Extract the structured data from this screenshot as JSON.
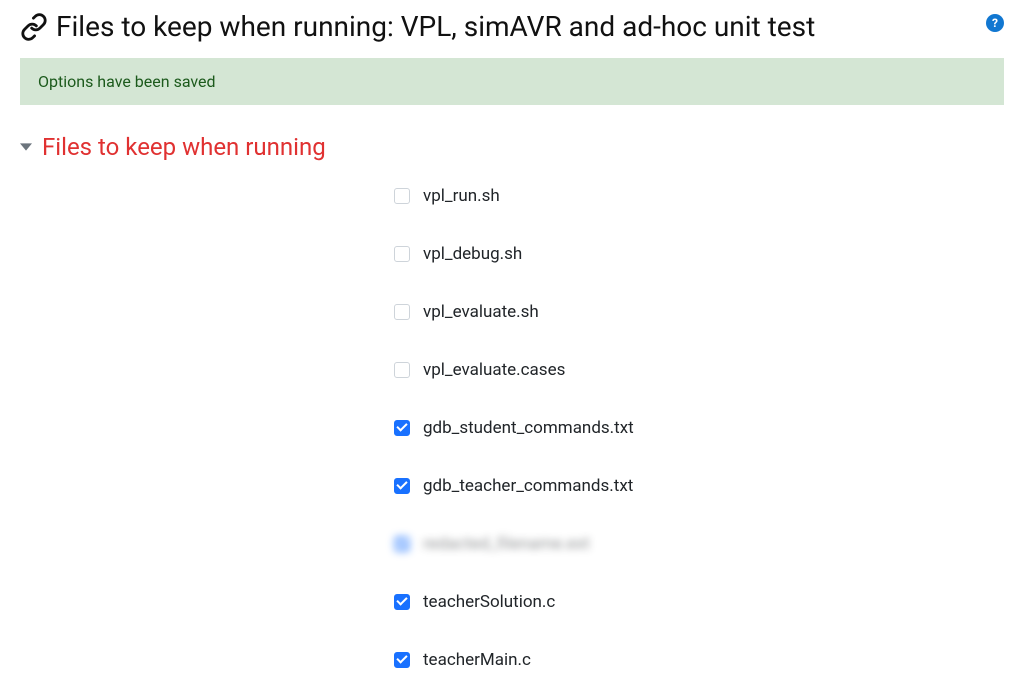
{
  "page_title": "Files to keep when running: VPL, simAVR and ad-hoc unit test",
  "status_message": "Options have been saved",
  "section_title": "Files to keep when running",
  "files": [
    {
      "label": "vpl_run.sh",
      "checked": false,
      "blurred": false
    },
    {
      "label": "vpl_debug.sh",
      "checked": false,
      "blurred": false
    },
    {
      "label": "vpl_evaluate.sh",
      "checked": false,
      "blurred": false
    },
    {
      "label": "vpl_evaluate.cases",
      "checked": false,
      "blurred": false
    },
    {
      "label": "gdb_student_commands.txt",
      "checked": true,
      "blurred": false
    },
    {
      "label": "gdb_teacher_commands.txt",
      "checked": true,
      "blurred": false
    },
    {
      "label": "redacted_filename.ext",
      "checked": true,
      "blurred": true
    },
    {
      "label": "teacherSolution.c",
      "checked": true,
      "blurred": false
    },
    {
      "label": "teacherMain.c",
      "checked": true,
      "blurred": false
    }
  ],
  "colors": {
    "accent_link": "#1971ff",
    "alert_bg": "#d4e6d4",
    "alert_text": "#1c5a1c",
    "section_heading": "#e03131",
    "help_bg": "#1177d1"
  }
}
